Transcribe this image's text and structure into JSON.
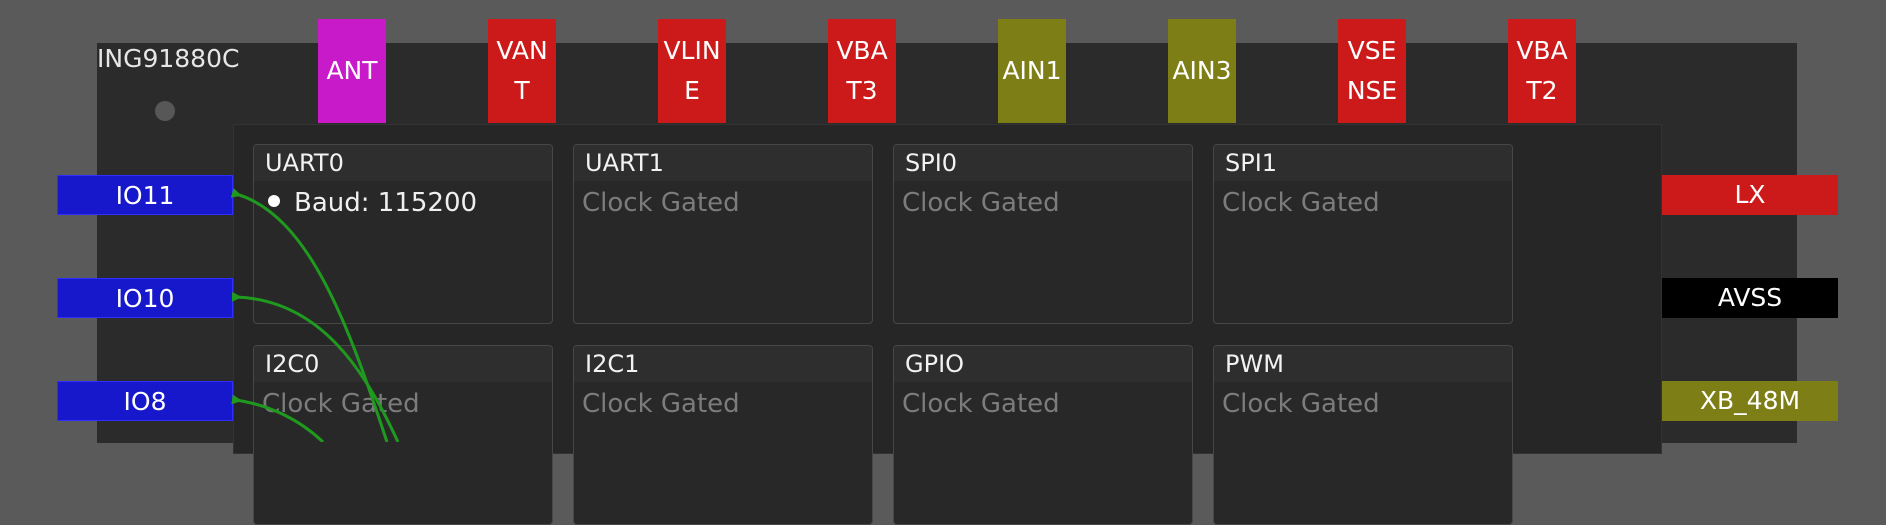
{
  "chip": {
    "name": "ING91880C"
  },
  "top_pins": [
    {
      "label": "ANT",
      "color": "#c81ac8"
    },
    {
      "label": "VANT",
      "color": "#cc1a1a"
    },
    {
      "label": "VLINE",
      "color": "#cc1a1a"
    },
    {
      "label": "VBAT3",
      "color": "#cc1a1a"
    },
    {
      "label": "AIN1",
      "color": "#7e7e17"
    },
    {
      "label": "AIN3",
      "color": "#7e7e17"
    },
    {
      "label": "VSENSE",
      "color": "#cc1a1a"
    },
    {
      "label": "VBAT2",
      "color": "#cc1a1a"
    }
  ],
  "left_pins": [
    {
      "label": "IO11"
    },
    {
      "label": "IO10"
    },
    {
      "label": "IO8"
    }
  ],
  "right_pins": [
    {
      "label": "LX",
      "color": "#cc1a1a"
    },
    {
      "label": "AVSS",
      "color": "#000000"
    },
    {
      "label": "XB_48M",
      "color": "#7e7e17"
    }
  ],
  "peripherals": [
    {
      "title": "UART0",
      "status": "Baud: 115200",
      "active": true
    },
    {
      "title": "UART1",
      "status": "Clock Gated"
    },
    {
      "title": "SPI0",
      "status": "Clock Gated"
    },
    {
      "title": "SPI1",
      "status": "Clock Gated"
    },
    {
      "title": "I2C0",
      "status": "Clock Gated"
    },
    {
      "title": "I2C1",
      "status": "Clock Gated"
    },
    {
      "title": "GPIO",
      "status": "Clock Gated"
    },
    {
      "title": "PWM",
      "status": "Clock Gated"
    }
  ],
  "colors": {
    "wire": "#1f9a1f",
    "io_pin": "#1717cc",
    "chip_bg": "#2b2b2b"
  }
}
